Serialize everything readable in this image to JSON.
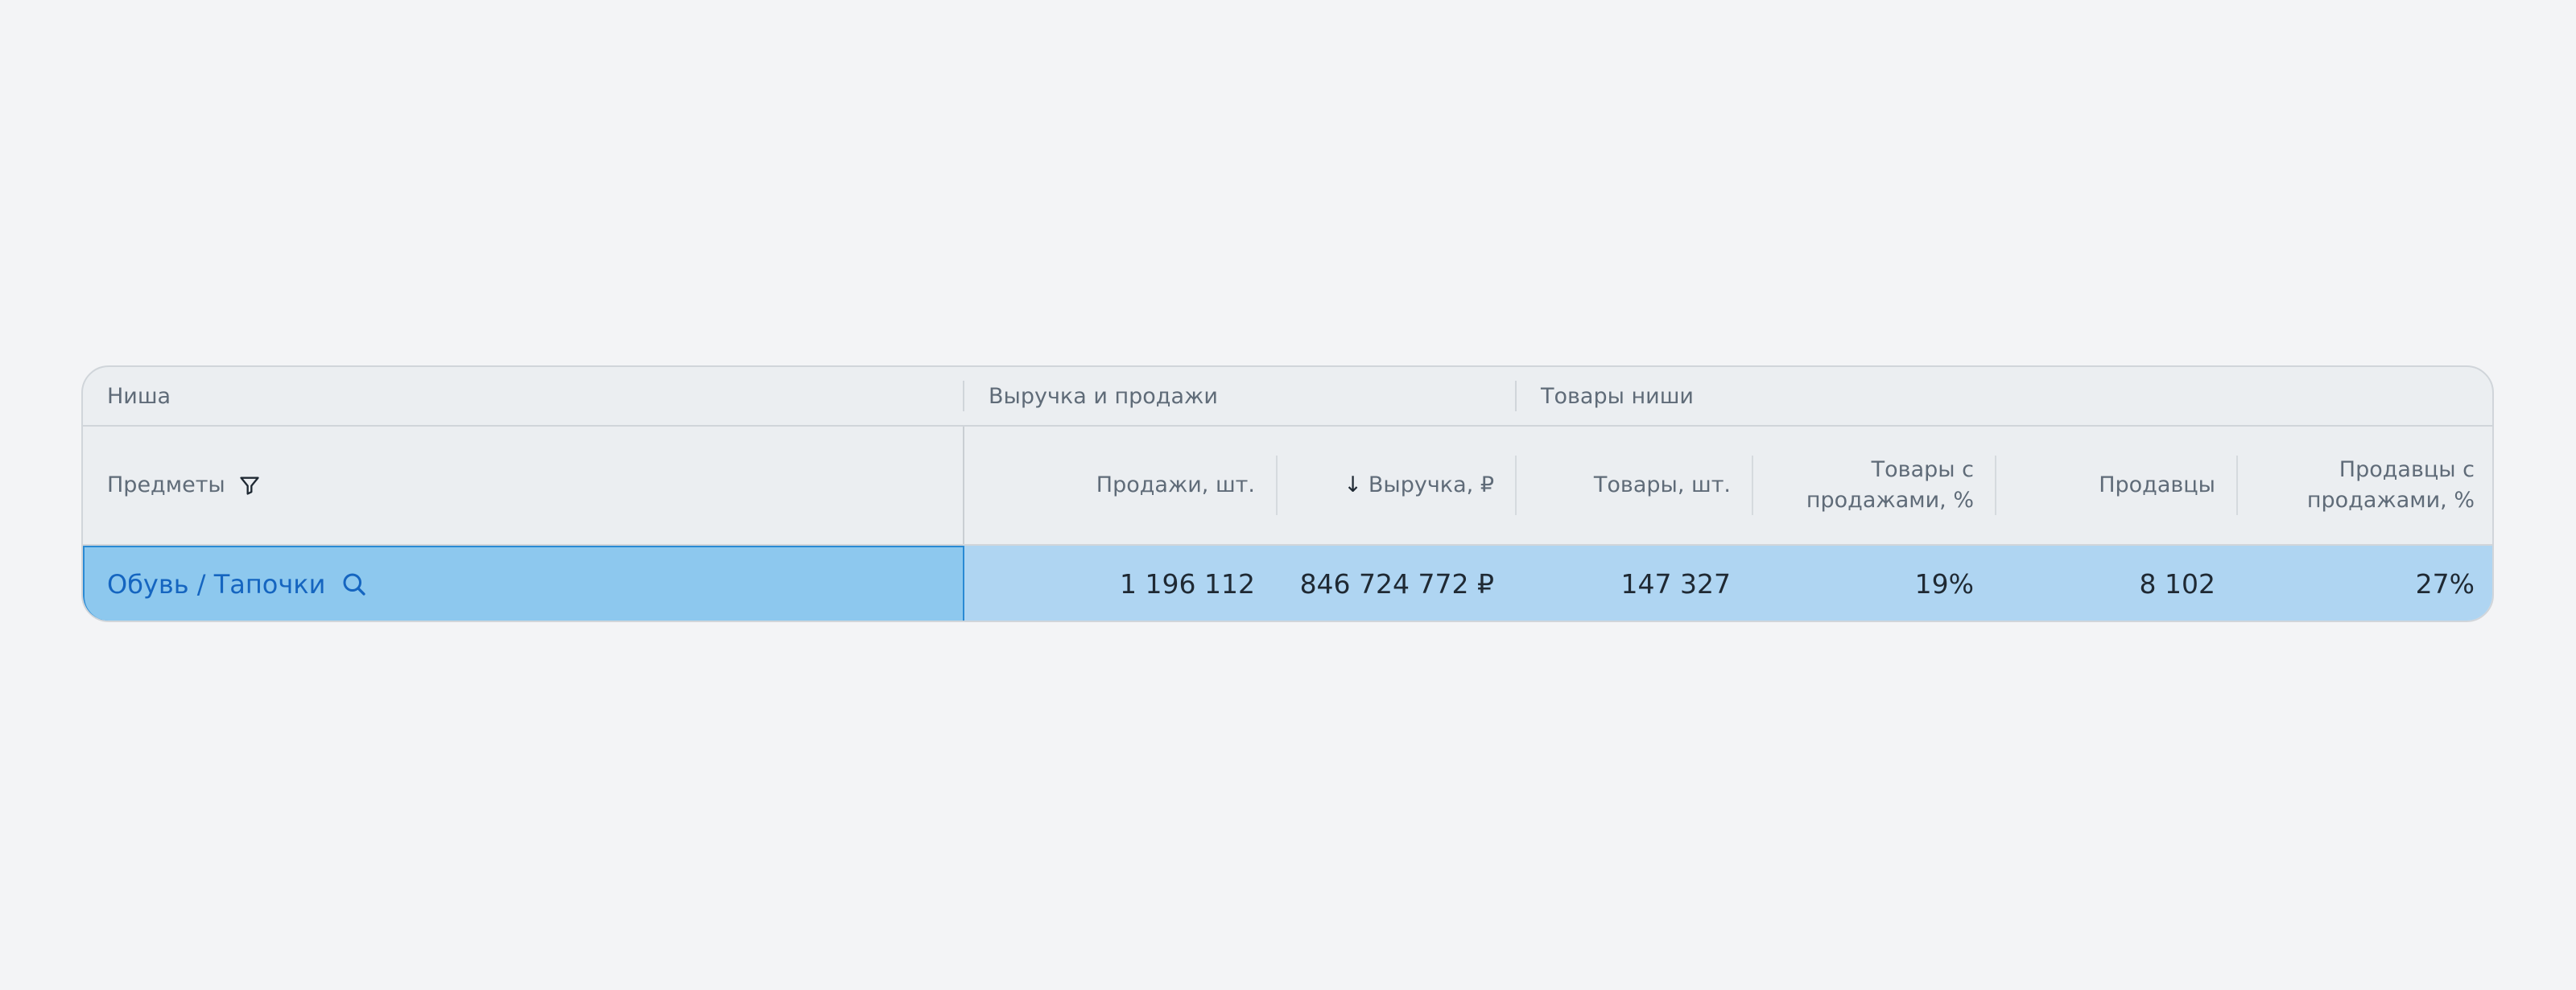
{
  "groups": {
    "niche": "Ниша",
    "revenue_sales": "Выручка и продажи",
    "niche_products": "Товары ниши"
  },
  "columns": {
    "subjects": "Предметы",
    "sales_units": "Продажи, шт.",
    "revenue_sort_arrow": "↓",
    "revenue": "Выручка, ₽",
    "products": "Товары, шт.",
    "products_with_sales_1": "Товары с",
    "products_with_sales_2": "продажами, %",
    "sellers": "Продавцы",
    "sellers_with_sales_1": "Продавцы с",
    "sellers_with_sales_2": "продажами, %"
  },
  "row": {
    "subject": "Обувь / Тапочки",
    "sales_units": "1 196 112",
    "revenue": "846 724 772 ₽",
    "products": "147 327",
    "products_with_sales": "19%",
    "sellers": "8 102",
    "sellers_with_sales": "27%"
  },
  "icons": {
    "subjects_filter": "filter-icon",
    "subject_search": "search-icon"
  },
  "colors": {
    "page_bg": "#f3f4f6",
    "header_bg": "#ebeef1",
    "row_bg": "#afd5f2",
    "selected_cell_bg": "#8dc8ee",
    "selected_cell_border": "#2a8ad4",
    "link_text": "#1565c0"
  }
}
